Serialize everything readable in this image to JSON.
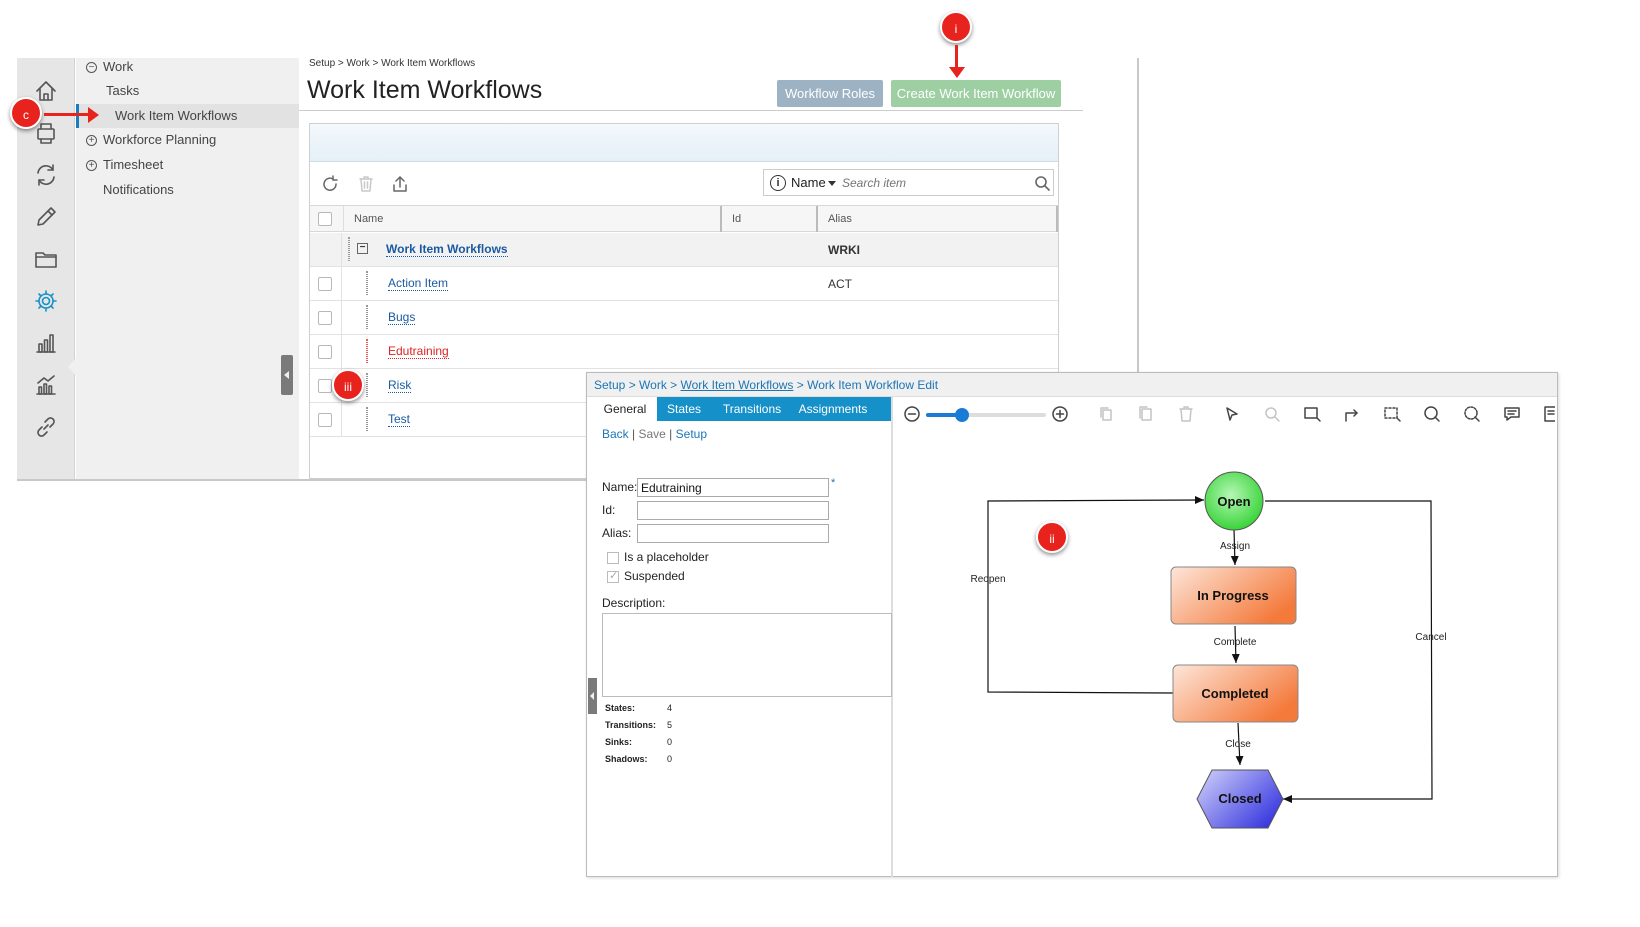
{
  "breadcrumb": "Setup > Work > Work Item Workflows",
  "page_title": "Work Item Workflows",
  "buttons": {
    "workflow_roles": "Workflow Roles",
    "create_workflow": "Create Work Item Workflow"
  },
  "nav": {
    "work": "Work",
    "tasks": "Tasks",
    "work_item_workflows": "Work Item Workflows",
    "workforce_planning": "Workforce Planning",
    "timesheet": "Timesheet",
    "notifications": "Notifications"
  },
  "rail_icons": [
    "home-icon",
    "print-icon",
    "sync-icon",
    "pencil-icon",
    "folder-icon",
    "gear-icon",
    "bar-chart-icon",
    "analytics-icon",
    "link-icon"
  ],
  "search": {
    "field": "Name",
    "placeholder": "Search item"
  },
  "grid": {
    "columns": {
      "name": "Name",
      "id": "Id",
      "alias": "Alias"
    },
    "group": {
      "name": "Work Item Workflows",
      "alias": "WRKI"
    },
    "rows": [
      {
        "name": "Action Item",
        "alias": "ACT"
      },
      {
        "name": "Bugs",
        "alias": ""
      },
      {
        "name": "Edutraining",
        "alias": ""
      },
      {
        "name": "Risk",
        "alias": ""
      },
      {
        "name": "Test",
        "alias": ""
      }
    ]
  },
  "callouts": {
    "c": "c",
    "i": "i",
    "ii": "ii",
    "iii": "iii"
  },
  "edit": {
    "crumb": {
      "setup": "Setup",
      "work": "Work",
      "workflows": "Work Item Workflows",
      "edit": "Work Item Workflow Edit",
      "sep": " > "
    },
    "tabs": [
      "General",
      "States",
      "Transitions",
      "Assignments"
    ],
    "links": {
      "back": "Back",
      "save": "Save",
      "setup": "Setup"
    },
    "fields": {
      "name_label": "Name:",
      "name_value": "Edutraining",
      "id_label": "Id:",
      "id_value": "",
      "alias_label": "Alias:",
      "alias_value": ""
    },
    "checkboxes": {
      "placeholder": "Is a placeholder",
      "placeholder_checked": false,
      "suspended": "Suspended",
      "suspended_checked": true
    },
    "description_label": "Description:",
    "stats": {
      "states_label": "States:",
      "states": "4",
      "transitions_label": "Transitions:",
      "transitions": "5",
      "sinks_label": "Sinks:",
      "sinks": "0",
      "shadows_label": "Shadows:",
      "shadows": "0"
    },
    "zoom_level": 0.3
  },
  "diagram": {
    "states": {
      "open": "Open",
      "in_progress": "In Progress",
      "completed": "Completed",
      "closed": "Closed"
    },
    "transitions": {
      "assign": "Assign",
      "complete": "Complete",
      "close": "Close",
      "reopen": "Reopen",
      "cancel": "Cancel"
    },
    "colors": {
      "open": "#3ad43a",
      "in_progress": "#f47a3c",
      "completed": "#f47a3c",
      "closed": "#4a4ae0",
      "callout": "#e8221c",
      "accent": "#1590c9"
    }
  }
}
